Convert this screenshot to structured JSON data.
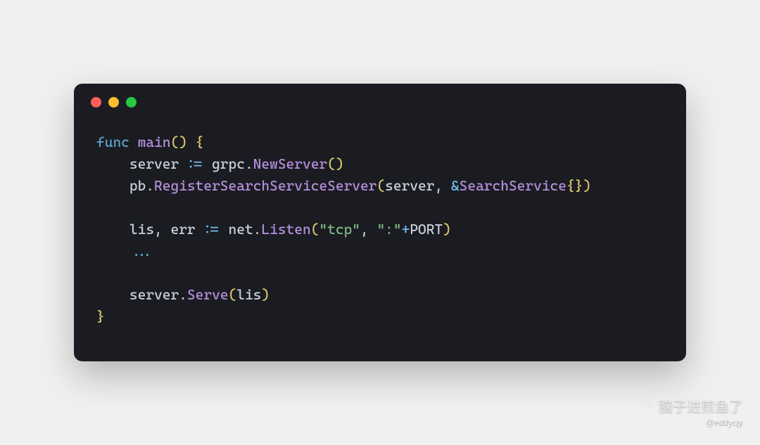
{
  "code": {
    "lines": [
      [
        {
          "t": "func ",
          "c": "tk-keyword"
        },
        {
          "t": "main",
          "c": "tk-func"
        },
        {
          "t": "(",
          "c": "tk-paren"
        },
        {
          "t": ")",
          "c": "tk-paren"
        },
        {
          "t": " ",
          "c": "tk-ident"
        },
        {
          "t": "{",
          "c": "tk-brace"
        }
      ],
      [
        {
          "t": "    server ",
          "c": "tk-ident"
        },
        {
          "t": ":=",
          "c": "tk-op"
        },
        {
          "t": " grpc",
          "c": "tk-ident"
        },
        {
          "t": ".",
          "c": "tk-ident"
        },
        {
          "t": "NewServer",
          "c": "tk-type"
        },
        {
          "t": "(",
          "c": "tk-paren"
        },
        {
          "t": ")",
          "c": "tk-paren"
        }
      ],
      [
        {
          "t": "    pb",
          "c": "tk-ident"
        },
        {
          "t": ".",
          "c": "tk-ident"
        },
        {
          "t": "RegisterSearchServiceServer",
          "c": "tk-type"
        },
        {
          "t": "(",
          "c": "tk-paren"
        },
        {
          "t": "server",
          "c": "tk-ident"
        },
        {
          "t": ",",
          "c": "tk-ident"
        },
        {
          "t": " ",
          "c": "tk-ident"
        },
        {
          "t": "&",
          "c": "tk-op"
        },
        {
          "t": "SearchService",
          "c": "tk-type"
        },
        {
          "t": "{",
          "c": "tk-brace"
        },
        {
          "t": "}",
          "c": "tk-brace"
        },
        {
          "t": ")",
          "c": "tk-paren"
        }
      ],
      [
        {
          "t": " ",
          "c": "tk-ident"
        }
      ],
      [
        {
          "t": "    lis",
          "c": "tk-ident"
        },
        {
          "t": ",",
          "c": "tk-ident"
        },
        {
          "t": " err ",
          "c": "tk-ident"
        },
        {
          "t": ":=",
          "c": "tk-op"
        },
        {
          "t": " net",
          "c": "tk-ident"
        },
        {
          "t": ".",
          "c": "tk-ident"
        },
        {
          "t": "Listen",
          "c": "tk-type"
        },
        {
          "t": "(",
          "c": "tk-paren"
        },
        {
          "t": "\"tcp\"",
          "c": "tk-string"
        },
        {
          "t": ",",
          "c": "tk-ident"
        },
        {
          "t": " ",
          "c": "tk-ident"
        },
        {
          "t": "\":\"",
          "c": "tk-string"
        },
        {
          "t": "+",
          "c": "tk-op"
        },
        {
          "t": "PORT",
          "c": "tk-ident"
        },
        {
          "t": ")",
          "c": "tk-paren"
        }
      ],
      [
        {
          "t": "    ",
          "c": "tk-ident"
        },
        {
          "t": "...",
          "c": "tk-op"
        }
      ],
      [
        {
          "t": " ",
          "c": "tk-ident"
        }
      ],
      [
        {
          "t": "    server",
          "c": "tk-ident"
        },
        {
          "t": ".",
          "c": "tk-ident"
        },
        {
          "t": "Serve",
          "c": "tk-type"
        },
        {
          "t": "(",
          "c": "tk-paren"
        },
        {
          "t": "lis",
          "c": "tk-ident"
        },
        {
          "t": ")",
          "c": "tk-paren"
        }
      ],
      [
        {
          "t": "}",
          "c": "tk-brace"
        }
      ]
    ]
  },
  "watermark": {
    "text": "脑子进煎鱼了",
    "handle": "@eddycjy"
  }
}
